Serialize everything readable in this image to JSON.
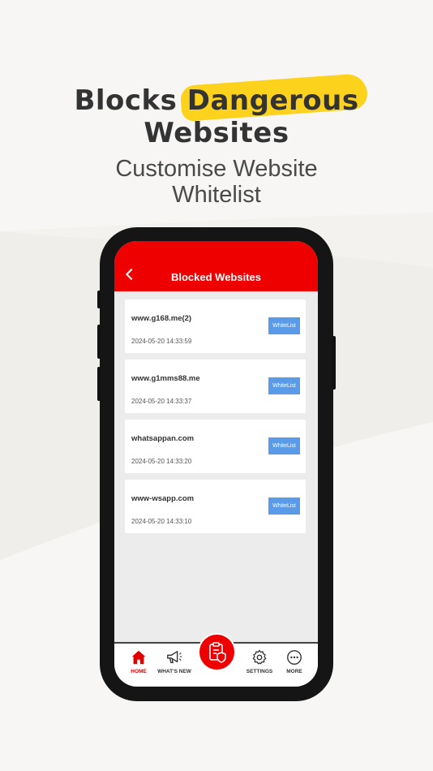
{
  "promo": {
    "headline_word1": "Blocks",
    "headline_highlight": "Dangerous",
    "headline_line2": "Websites",
    "subline_1": "Customise Website",
    "subline_2": "Whitelist"
  },
  "app": {
    "title": "Blocked Websites",
    "items": [
      {
        "site": "www.g168.me(2)",
        "time": "2024-05-20 14:33:59",
        "action": "WhiteList"
      },
      {
        "site": "www.g1mms88.me",
        "time": "2024-05-20 14:33:37",
        "action": "WhiteList"
      },
      {
        "site": "whatsappan.com",
        "time": "2024-05-20 14:33:20",
        "action": "WhiteList"
      },
      {
        "site": "www-wsapp.com",
        "time": "2024-05-20 14:33:10",
        "action": "WhiteList"
      }
    ],
    "nav": {
      "home": "HOME",
      "whats_new": "WHAT'S NEW",
      "settings": "SETTINGS",
      "more": "MORE"
    }
  },
  "colors": {
    "brand_red": "#ee0000",
    "highlight_yellow": "#fdd21d",
    "whitelist_blue": "#5a9be9"
  },
  "icons": {
    "back": "chevron-left-icon",
    "home": "home-icon",
    "whats_new": "megaphone-icon",
    "fab": "clipboard-shield-icon",
    "settings": "gear-icon",
    "more": "more-dots-icon"
  }
}
